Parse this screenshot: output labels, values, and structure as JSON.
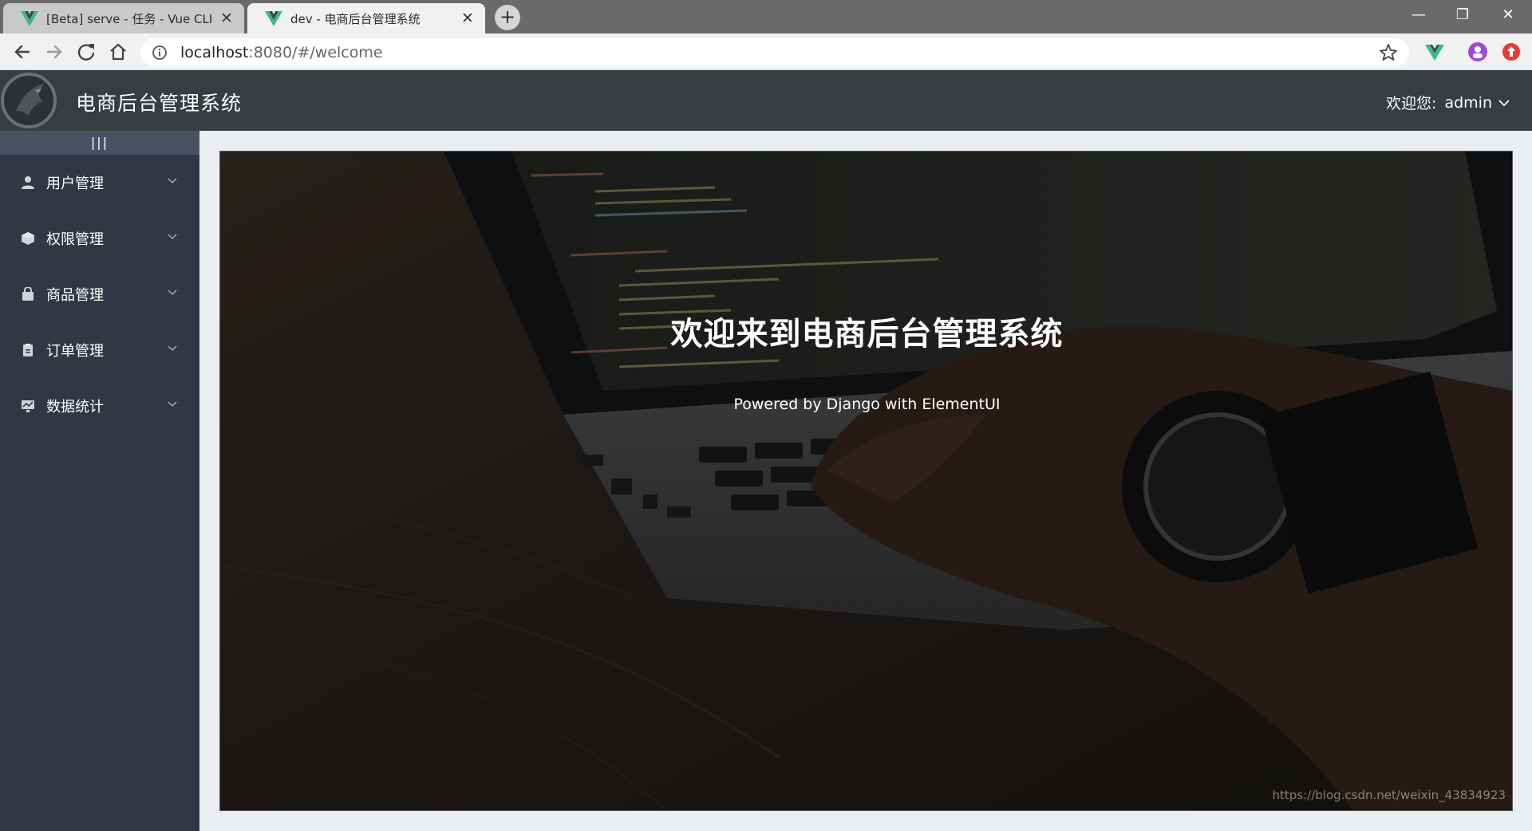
{
  "browser": {
    "tabs": [
      {
        "title": "[Beta] serve - 任务 - Vue CLI",
        "active": false
      },
      {
        "title": "dev - 电商后台管理系统",
        "active": true
      }
    ],
    "url_host": "localhost",
    "url_rest": ":8080/#/welcome",
    "colors": {
      "vue_green": "#41b883",
      "vue_dark": "#35495e"
    }
  },
  "header": {
    "title": "电商后台管理系统",
    "user_prefix": "欢迎您:",
    "username": "admin",
    "background": "#373d41"
  },
  "sidebar": {
    "toggle_label": "|||",
    "background": "#333744",
    "items": [
      {
        "label": "用户管理",
        "icon": "user-icon"
      },
      {
        "label": "权限管理",
        "icon": "box-icon"
      },
      {
        "label": "商品管理",
        "icon": "shopping-bag-icon"
      },
      {
        "label": "订单管理",
        "icon": "document-icon"
      },
      {
        "label": "数据统计",
        "icon": "chart-icon"
      }
    ]
  },
  "welcome": {
    "heading": "欢迎来到电商后台管理系统",
    "subtitle": "Powered by Django with ElementUI",
    "watermark": "https://blog.csdn.net/weixin_43834923"
  }
}
